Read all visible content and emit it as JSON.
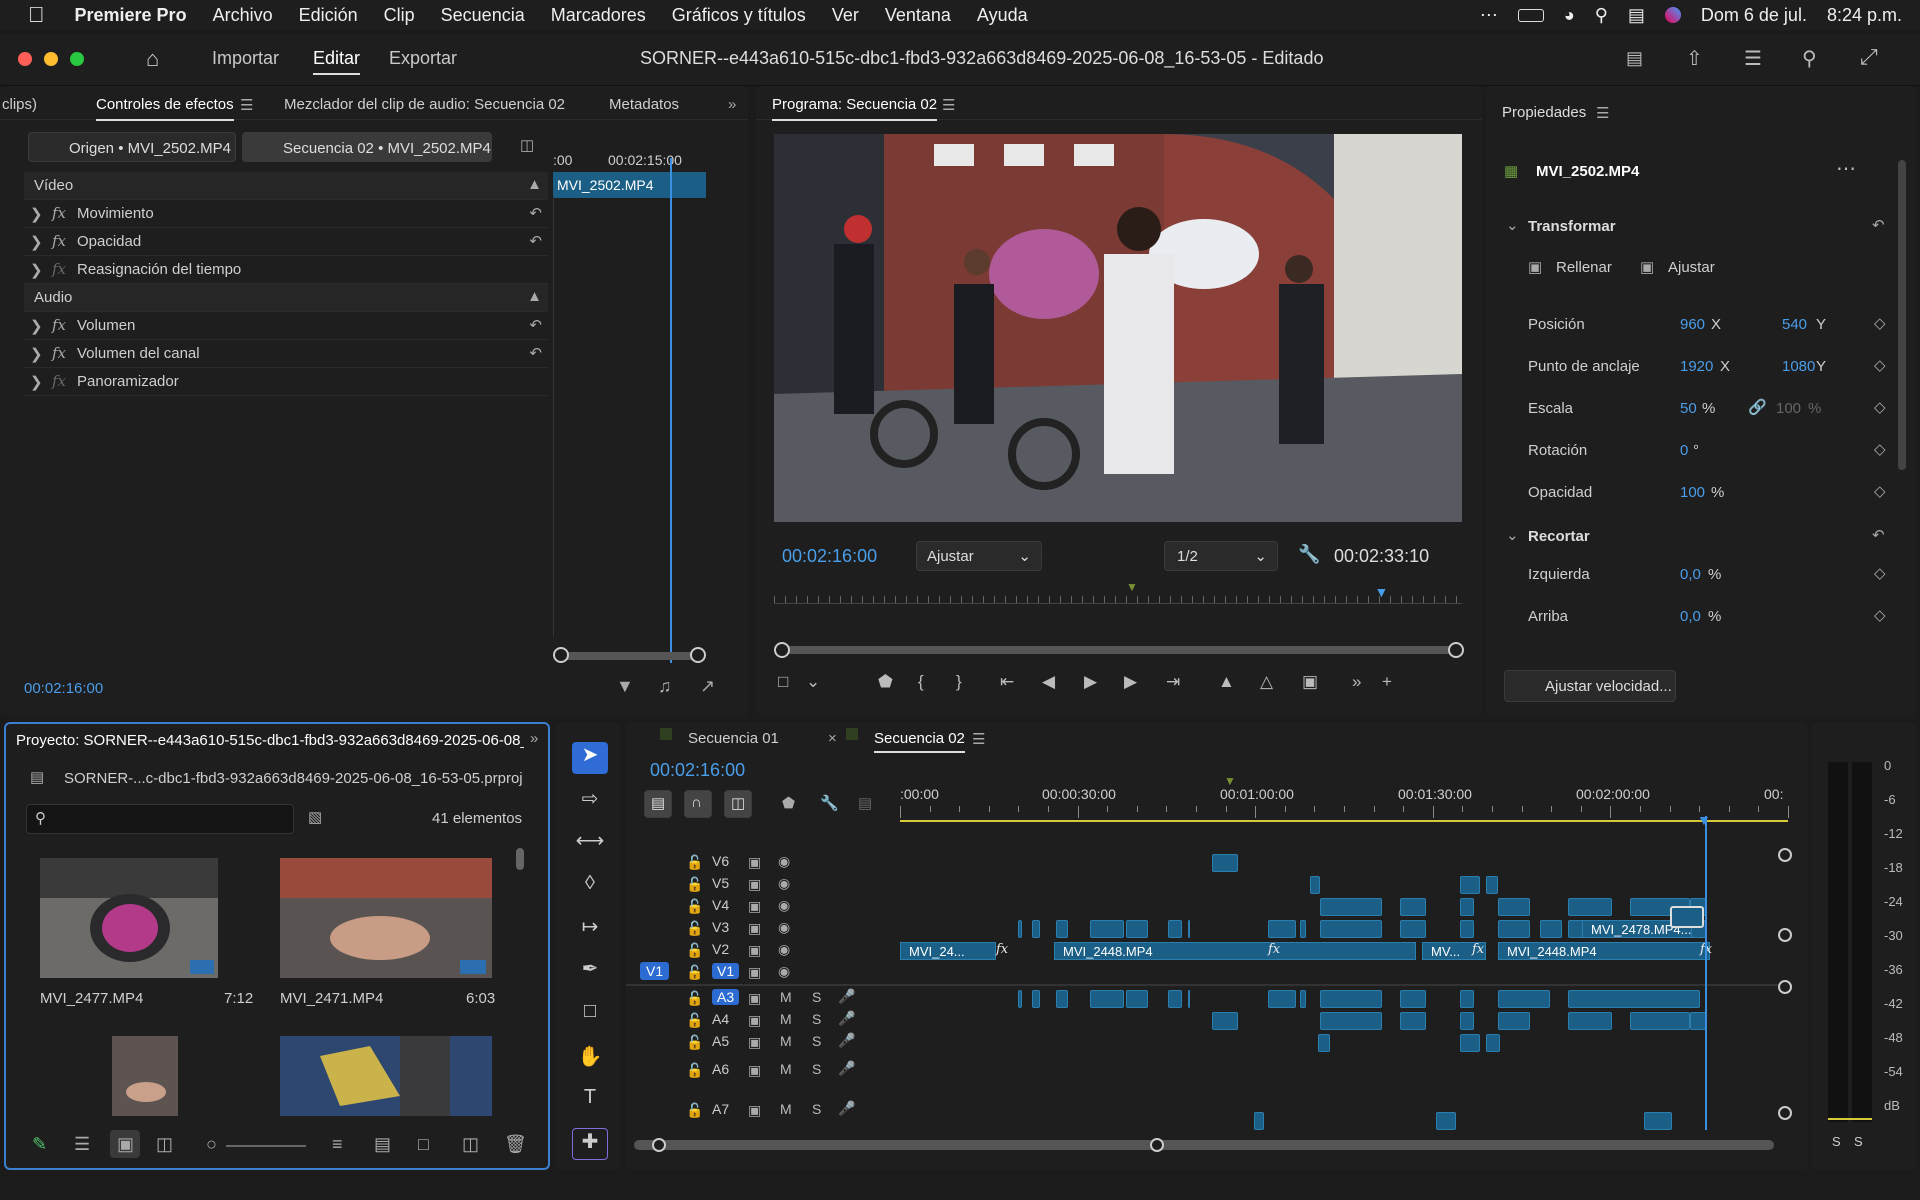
{
  "menubar": {
    "apple": "",
    "app": "Premiere Pro",
    "items": [
      "Archivo",
      "Edición",
      "Clip",
      "Secuencia",
      "Marcadores",
      "Gráficos y títulos",
      "Ver",
      "Ventana",
      "Ayuda"
    ],
    "date": "Dom 6 de jul.",
    "time": "8:24 p.m."
  },
  "titlebar": {
    "workspaces": [
      "Importar",
      "Editar",
      "Exportar"
    ],
    "active": "Editar",
    "title": "SORNER--e443a610-515c-dbc1-fbd3-932a663d8469-2025-06-08_16-53-05 - Editado"
  },
  "effects": {
    "tabs": [
      "clips)",
      "Controles de efectos",
      "Mezclador del clip de audio: Secuencia 02",
      "Metadatos"
    ],
    "source_tab": "Origen • MVI_2502.MP4",
    "seq_tab": "Secuencia 02 • MVI_2502.MP4",
    "ruler_start": ":00",
    "ruler_mid": "00:02:15:00",
    "clip_name": "MVI_2502.MP4",
    "video_header": "Vídeo",
    "audio_header": "Audio",
    "video_rows": [
      "Movimiento",
      "Opacidad",
      "Reasignación del tiempo"
    ],
    "audio_rows": [
      "Volumen",
      "Volumen del canal",
      "Panoramizador"
    ],
    "timecode": "00:02:16:00"
  },
  "program": {
    "title": "Programa: Secuencia 02",
    "timecode": "00:02:16:00",
    "fit": "Ajustar",
    "res": "1/2",
    "duration": "00:02:33:10",
    "playhead_fraction": 0.883
  },
  "properties": {
    "title": "Propiedades",
    "clip": "MVI_2502.MP4",
    "transform": "Transformar",
    "fill": "Rellenar",
    "fit": "Ajustar",
    "rows": [
      {
        "label": "Posición",
        "v1": "960",
        "u1": "X",
        "v2": "540",
        "u2": "Y"
      },
      {
        "label": "Punto de anclaje",
        "v1": "1920",
        "u1": "X",
        "v2": "1080",
        "u2": "Y"
      },
      {
        "label": "Escala",
        "v1": "50",
        "u1": "%",
        "v2": "100",
        "u2": "%"
      },
      {
        "label": "Rotación",
        "v1": "0",
        "u1": "°",
        "v2": "",
        "u2": ""
      },
      {
        "label": "Opacidad",
        "v1": "100",
        "u1": "%",
        "v2": "",
        "u2": ""
      }
    ],
    "crop": "Recortar",
    "crop_rows": [
      {
        "label": "Izquierda",
        "v1": "0,0",
        "u1": "%"
      },
      {
        "label": "Arriba",
        "v1": "0,0",
        "u1": "%"
      }
    ],
    "speed_btn": "Ajustar velocidad..."
  },
  "project": {
    "title": "Proyecto: SORNER--e443a610-515c-dbc1-fbd3-932a663d8469-2025-06-08_16",
    "file": "SORNER-...c-dbc1-fbd3-932a663d8469-2025-06-08_16-53-05.prproj",
    "count": "41 elementos",
    "search_placeholder": "",
    "items": [
      {
        "name": "MVI_2477.MP4",
        "dur": "7:12"
      },
      {
        "name": "MVI_2471.MP4",
        "dur": "6:03"
      }
    ]
  },
  "timeline": {
    "tabs": [
      "Secuencia 01",
      "Secuencia 02"
    ],
    "timecode": "00:02:16:00",
    "ruler": [
      ":00:00",
      "00:00:30:00",
      "00:01:00:00",
      "00:01:30:00",
      "00:02:00:00",
      "00:"
    ],
    "video_tracks": [
      "V6",
      "V5",
      "V4",
      "V3",
      "V2",
      "V1"
    ],
    "audio_tracks": [
      "A3",
      "A4",
      "A5",
      "A6",
      "A7"
    ],
    "src_v": "V1",
    "clips": [
      "MVI_24...",
      "MVI_2448.MP4",
      "MV...",
      "MVI_2448.MP4",
      "MVI_2478.MP4..."
    ],
    "m": "M",
    "s": "S"
  },
  "meter": {
    "scale": [
      "0",
      "-6",
      "-12",
      "-18",
      "-24",
      "-30",
      "-36",
      "-42",
      "-48",
      "-54",
      "dB"
    ],
    "ss": [
      "S",
      "S"
    ]
  }
}
